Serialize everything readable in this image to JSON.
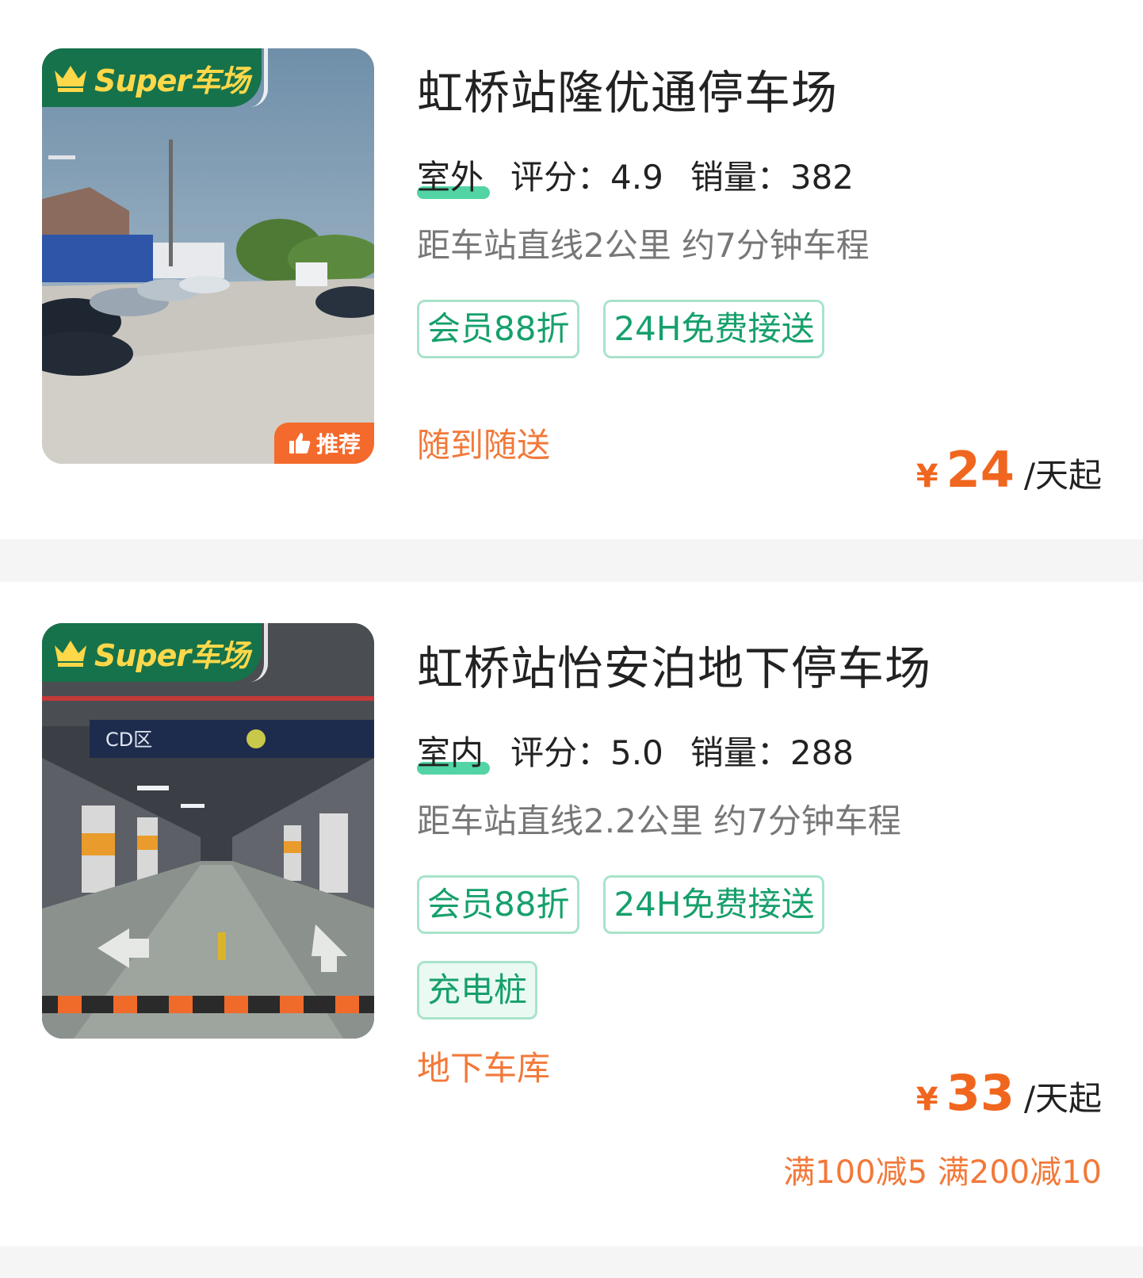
{
  "listings": [
    {
      "badge": "Super车场",
      "recommend": "推荐",
      "name": "虹桥站隆优通停车场",
      "type": "室外",
      "rating_label": "评分：",
      "rating": "4.9",
      "sales_label": "销量：",
      "sales": "382",
      "distance": "距车站直线2公里 约7分钟车程",
      "tags": [
        "会员88折",
        "24H免费接送"
      ],
      "feature": "随到随送",
      "currency": "¥",
      "price": "24",
      "price_unit": "/天起"
    },
    {
      "badge": "Super车场",
      "name": "虹桥站怡安泊地下停车场",
      "type": "室内",
      "rating_label": "评分：",
      "rating": "5.0",
      "sales_label": "销量：",
      "sales": "288",
      "distance": "距车站直线2.2公里 约7分钟车程",
      "tags": [
        "会员88折",
        "24H免费接送"
      ],
      "tag_extra": "充电桩",
      "feature": "地下车库",
      "currency": "¥",
      "price": "33",
      "price_unit": "/天起",
      "promo": "满100减5 满200减10",
      "sign_text": "CD区"
    }
  ],
  "colors": {
    "brand_green": "#16724a",
    "badge_gold": "#ffd84a",
    "accent_orange": "#f0661f",
    "tag_green": "#16a06b"
  }
}
